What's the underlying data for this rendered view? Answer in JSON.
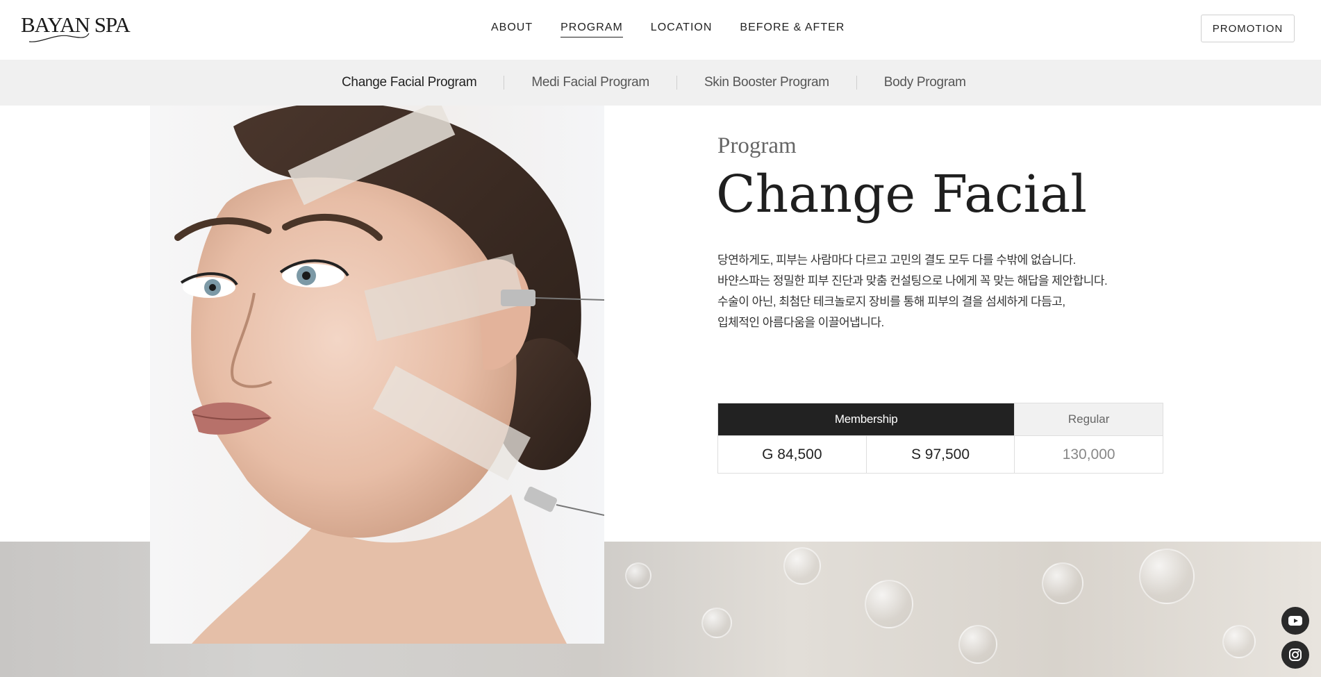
{
  "brand": {
    "name": "BAYAN SPA"
  },
  "nav": {
    "items": [
      {
        "label": "ABOUT",
        "active": false
      },
      {
        "label": "PROGRAM",
        "active": true
      },
      {
        "label": "LOCATION",
        "active": false
      },
      {
        "label": "BEFORE & AFTER",
        "active": false
      }
    ],
    "promotion_label": "PROMOTION"
  },
  "subnav": {
    "items": [
      {
        "label": "Change Facial Program",
        "active": true
      },
      {
        "label": "Medi Facial Program",
        "active": false
      },
      {
        "label": "Skin Booster Program",
        "active": false
      },
      {
        "label": "Body Program",
        "active": false
      }
    ]
  },
  "program": {
    "label": "Program",
    "title": "Change Facial",
    "description": [
      "당연하게도, 피부는 사람마다 다르고 고민의 결도 모두 다를 수밖에 없습니다.",
      "바얀스파는 정밀한 피부 진단과 맞춤 컨설팅으로 나에게 꼭 맞는 해답을 제안합니다.",
      "수술이 아닌, 최첨단 테크놀로지 장비를 통해 피부의 결을 섬세하게 다듬고,",
      "입체적인 아름다움을 이끌어냅니다."
    ]
  },
  "pricing": {
    "membership_label": "Membership",
    "regular_label": "Regular",
    "membership_gold": "G 84,500",
    "membership_silver": "S 97,500",
    "regular_price": "130,000"
  },
  "social": [
    {
      "icon": "youtube-icon"
    },
    {
      "icon": "instagram-icon"
    }
  ],
  "colors": {
    "accent_dark": "#222222",
    "subnav_bg": "#f0f0f0"
  }
}
